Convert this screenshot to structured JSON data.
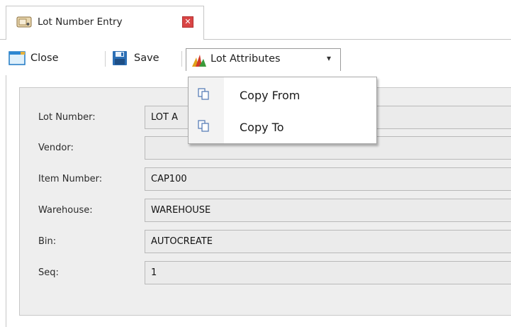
{
  "tab": {
    "title": "Lot Number Entry",
    "close_glyph": "✕"
  },
  "toolbar": {
    "close_label": "Close",
    "save_label": "Save",
    "lot_attributes_label": "Lot Attributes",
    "dropdown_arrow": "▾"
  },
  "menu": {
    "items": [
      {
        "label": "Copy From",
        "icon": "copy-icon"
      },
      {
        "label": "Copy To",
        "icon": "copy-icon"
      }
    ]
  },
  "form": {
    "fields": [
      {
        "label": "Lot Number:",
        "value": "LOT A"
      },
      {
        "label": "Vendor:",
        "value": ""
      },
      {
        "label": "Item Number:",
        "value": "CAP100"
      },
      {
        "label": "Warehouse:",
        "value": "WAREHOUSE"
      },
      {
        "label": "Bin:",
        "value": "AUTOCREATE"
      },
      {
        "label": "Seq:",
        "value": "1"
      }
    ]
  },
  "colors": {
    "tab_close_red": "#d94545",
    "field_bg": "#ebebeb",
    "panel_bg": "#eeeeee"
  }
}
